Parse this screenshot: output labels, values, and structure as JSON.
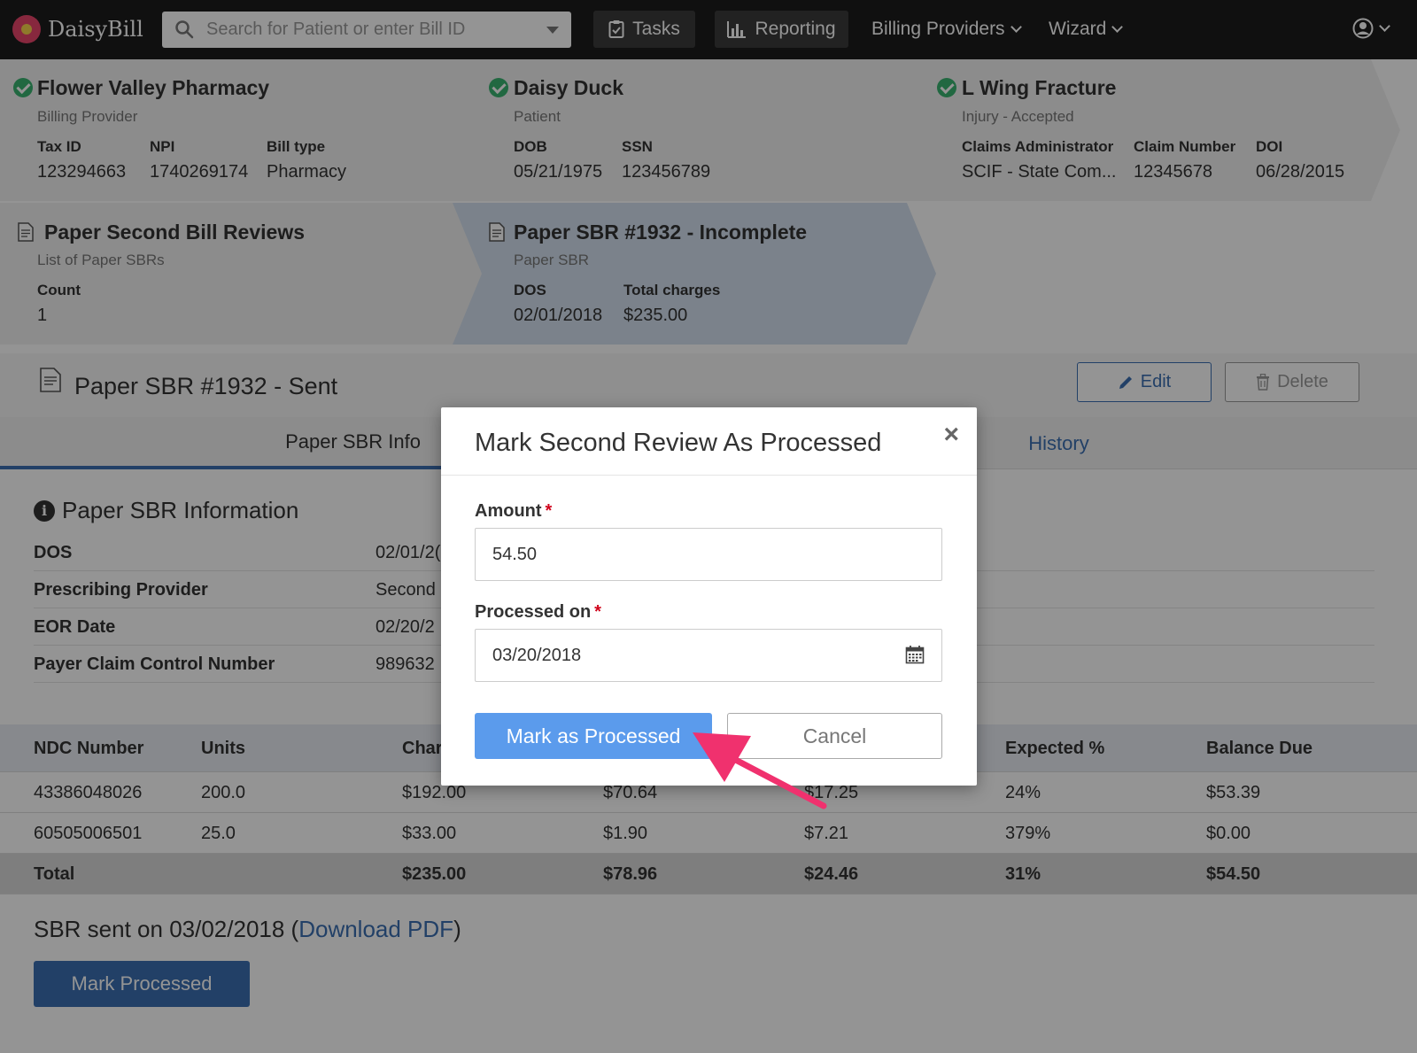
{
  "nav": {
    "logo_text": "DaisyBill",
    "search_placeholder": "Search for Patient or enter Bill ID",
    "tasks_label": "Tasks",
    "reporting_label": "Reporting",
    "billing_providers_label": "Billing Providers",
    "wizard_label": "Wizard"
  },
  "crumbs": {
    "provider": {
      "name": "Flower Valley Pharmacy",
      "sub": "Billing Provider",
      "fields": [
        {
          "label": "Tax ID",
          "value": "123294663"
        },
        {
          "label": "NPI",
          "value": "1740269174"
        },
        {
          "label": "Bill type",
          "value": "Pharmacy"
        }
      ]
    },
    "patient": {
      "name": "Daisy Duck",
      "sub": "Patient",
      "fields": [
        {
          "label": "DOB",
          "value": "05/21/1975"
        },
        {
          "label": "SSN",
          "value": "123456789"
        }
      ]
    },
    "injury": {
      "name": "L Wing Fracture",
      "sub": "Injury - Accepted",
      "fields": [
        {
          "label": "Claims Administrator",
          "value": "SCIF - State Com..."
        },
        {
          "label": "Claim Number",
          "value": "12345678"
        },
        {
          "label": "DOI",
          "value": "06/28/2015"
        }
      ]
    },
    "list": {
      "name": "Paper Second Bill Reviews",
      "sub": "List of Paper SBRs",
      "fields": [
        {
          "label": "Count",
          "value": "1"
        }
      ]
    },
    "current": {
      "name": "Paper SBR #1932 - Incomplete",
      "sub": "Paper SBR",
      "fields": [
        {
          "label": "DOS",
          "value": "02/01/2018"
        },
        {
          "label": "Total charges",
          "value": "$235.00"
        }
      ]
    }
  },
  "page": {
    "title": "Paper SBR #1932 - Sent",
    "edit_label": "Edit",
    "delete_label": "Delete"
  },
  "tabs": {
    "info_label": "Paper SBR Info",
    "history_label": "History"
  },
  "info": {
    "title": "Paper SBR Information",
    "rows": [
      {
        "key": "DOS",
        "value": "02/01/2("
      },
      {
        "key": "Prescribing Provider",
        "value": "Second"
      },
      {
        "key": "EOR Date",
        "value": "02/20/2"
      },
      {
        "key": "Payer Claim Control Number",
        "value": "989632"
      }
    ]
  },
  "table": {
    "headers": [
      "NDC Number",
      "Units",
      "Char",
      "",
      "",
      "Expected %",
      "Balance Due"
    ],
    "rows": [
      [
        "43386048026",
        "200.0",
        "$192.00",
        "$70.64",
        "$17.25",
        "24%",
        "$53.39"
      ],
      [
        "60505006501",
        "25.0",
        "$33.00",
        "$1.90",
        "$7.21",
        "379%",
        "$0.00"
      ]
    ],
    "total": [
      "Total",
      "",
      "$235.00",
      "$78.96",
      "$24.46",
      "31%",
      "$54.50"
    ]
  },
  "bottom": {
    "sent_prefix": "SBR sent on 03/02/2018 (",
    "download_link": "Download PDF",
    "sent_suffix": ")",
    "mark_processed_label": "Mark Processed"
  },
  "modal": {
    "title": "Mark Second Review As Processed",
    "close_glyph": "×",
    "amount_label": "Amount",
    "amount_value": "54.50",
    "processed_label": "Processed on",
    "processed_value": "03/20/2018",
    "required_mark": "*",
    "submit_label": "Mark as Processed",
    "cancel_label": "Cancel"
  },
  "colors": {
    "accent_blue": "#3b6fb1",
    "primary_button": "#5b9bec",
    "check_green": "#39b370",
    "annotation_arrow": "#f0316e"
  }
}
